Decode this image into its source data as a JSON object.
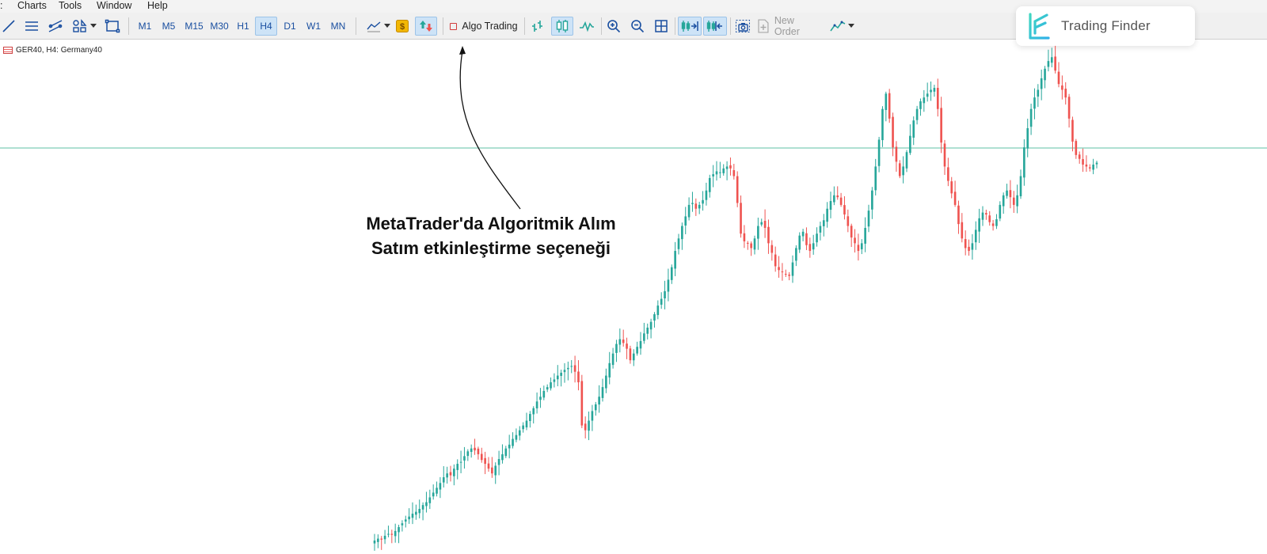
{
  "menu": {
    "items": [
      "Charts",
      "Tools",
      "Window",
      "Help"
    ]
  },
  "toolbar": {
    "timeframes": [
      "M1",
      "M5",
      "M15",
      "M30",
      "H1",
      "H4",
      "D1",
      "W1",
      "MN"
    ],
    "active_timeframe": "H4",
    "algo_trading_label": "Algo Trading",
    "new_order_label": "New Order"
  },
  "symbol": {
    "label": "GER40, H4:  Germany40"
  },
  "watermark": {
    "brand": "Trading Finder"
  },
  "annotation": {
    "line1": "MetaTrader'da Algoritmik Alım",
    "line2": "Satım etkinleştirme seçeneği"
  },
  "colors": {
    "bull": "#26a69a",
    "bear": "#ef5350",
    "price_line": "#5fc0a6",
    "accent": "#1a4fa0"
  },
  "chart_data": {
    "type": "candlestick",
    "title": "",
    "symbol": "GER40",
    "timeframe": "H4",
    "price_level_note": "horizontal price line",
    "closes": [
      90,
      92,
      91,
      95,
      97,
      96,
      100,
      104,
      108,
      112,
      115,
      118,
      120,
      123,
      127,
      130,
      135,
      140,
      145,
      150,
      156,
      160,
      158,
      165,
      170,
      172,
      178,
      183,
      186,
      184,
      180,
      174,
      170,
      165,
      160,
      168,
      175,
      180,
      186,
      190,
      196,
      200,
      205,
      210,
      215,
      222,
      228,
      235,
      240,
      246,
      250,
      255,
      258,
      262,
      265,
      268,
      270,
      272,
      266,
      255,
      210,
      205,
      215,
      225,
      232,
      240,
      250,
      262,
      275,
      285,
      295,
      300,
      296,
      290,
      278,
      285,
      292,
      298,
      306,
      312,
      318,
      326,
      335,
      342,
      350,
      362,
      375,
      392,
      405,
      418,
      428,
      440,
      442,
      436,
      440,
      445,
      455,
      468,
      472,
      475,
      474,
      478,
      480,
      478,
      470,
      442,
      410,
      402,
      400,
      395,
      405,
      418,
      422,
      416,
      400,
      390,
      376,
      372,
      370,
      368,
      366,
      380,
      395,
      408,
      412,
      398,
      392,
      400,
      410,
      418,
      424,
      436,
      444,
      450,
      448,
      440,
      430,
      418,
      406,
      400,
      392,
      400,
      416,
      434,
      455,
      480,
      508,
      540,
      556,
      530,
      500,
      485,
      470,
      480,
      495,
      512,
      528,
      540,
      548,
      552,
      556,
      560,
      562,
      540,
      505,
      480,
      465,
      452,
      440,
      420,
      405,
      395,
      392,
      400,
      414,
      426,
      432,
      430,
      422,
      418,
      425,
      440,
      450,
      455,
      448,
      440,
      450,
      470,
      500,
      520,
      540,
      552,
      560,
      572,
      582,
      590,
      594,
      580,
      566,
      560,
      552,
      530,
      506,
      492,
      488,
      482,
      480,
      478,
      482,
      484
    ]
  }
}
